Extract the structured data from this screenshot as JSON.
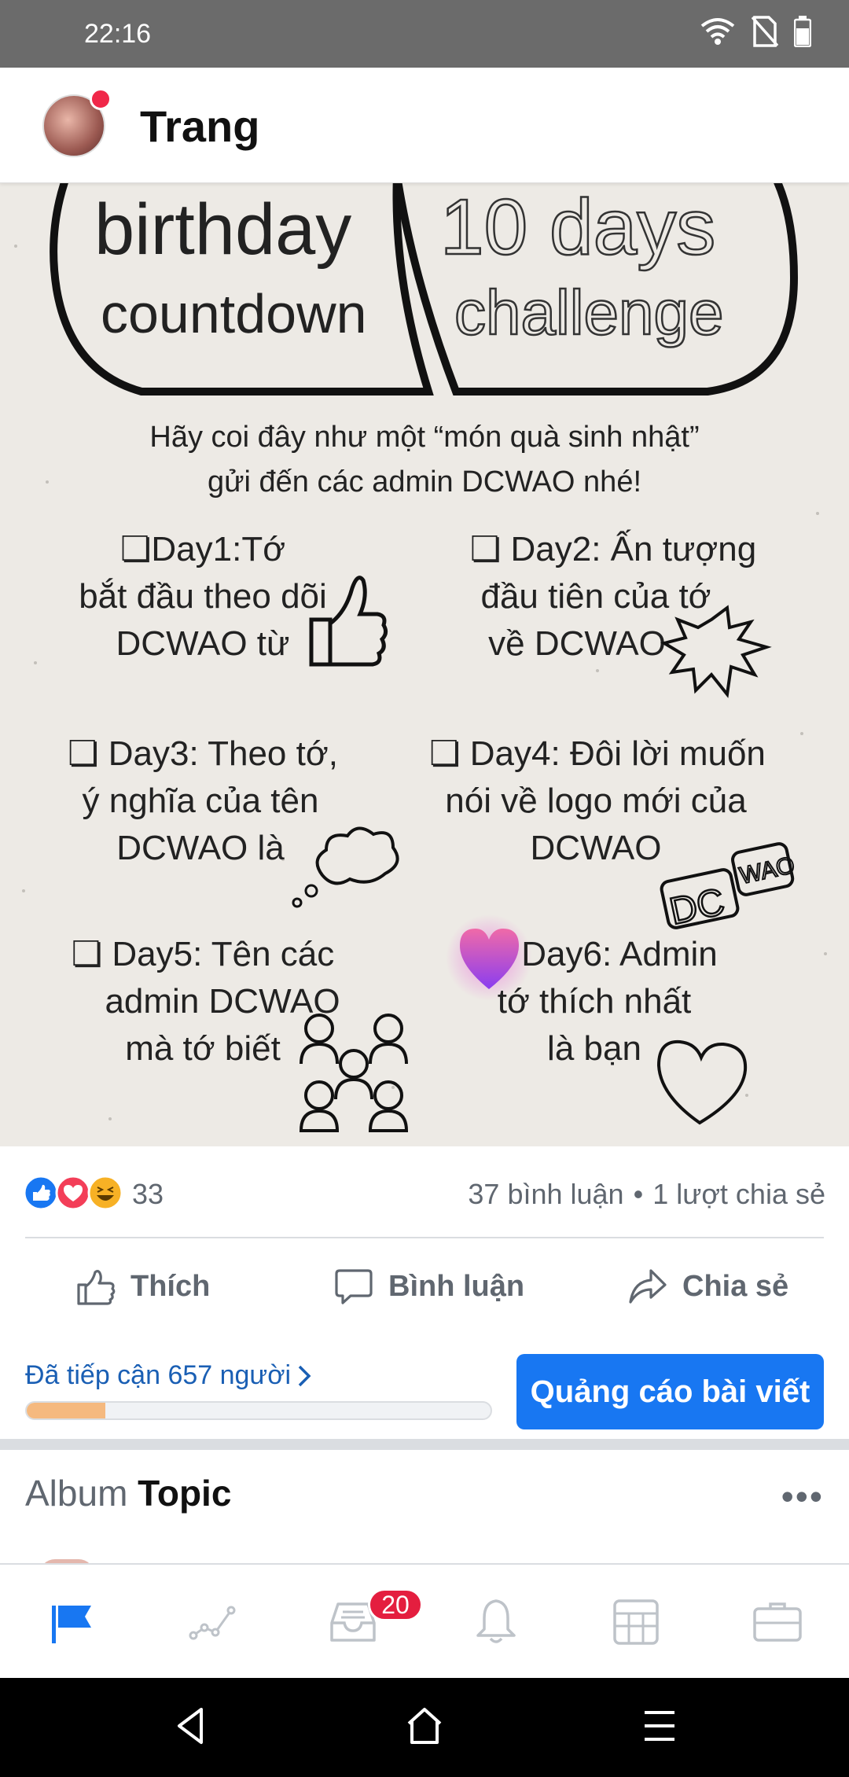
{
  "status_bar": {
    "time": "22:16"
  },
  "header": {
    "page_name": "Trang"
  },
  "post_image": {
    "title_left_1": "birthday",
    "title_left_2": "countdown",
    "title_right_1": "10 days",
    "title_right_2": "challenge",
    "intro_1": "Hãy coi đây như một  “món quà sinh nhật”",
    "intro_2": "gửi đến các admin DCWAO nhé!",
    "day1": [
      "❏Day1:Tớ",
      "bắt đầu theo dõi",
      "DCWAO từ"
    ],
    "day2": [
      "❏ Day2: Ấn tượng",
      "đầu tiên của tớ",
      "về DCWAO"
    ],
    "day3": [
      "❏ Day3: Theo tớ,",
      "ý nghĩa của tên",
      "DCWAO là"
    ],
    "day4": [
      "❏ Day4: Đôi lời muốn",
      "nói về logo mới của",
      "DCWAO"
    ],
    "day5": [
      "❏ Day5: Tên các",
      "admin DCWAO",
      "mà tớ biết"
    ],
    "day6": [
      "Day6: Admin",
      "tớ thích nhất",
      "là bạn"
    ],
    "logo_text_1": "DC",
    "logo_text_2": "WAO"
  },
  "reactions": {
    "count": "33",
    "comments": "37 bình luận",
    "separator": "•",
    "shares": "1 lượt chia sẻ"
  },
  "actions": {
    "like": "Thích",
    "comment": "Bình luận",
    "share": "Chia sẻ"
  },
  "reach": {
    "label": "Đã tiếp cận 657 người",
    "progress_fraction": 0.17,
    "promote_label": "Quảng cáo bài viết"
  },
  "album": {
    "prefix": "Album",
    "name": "Topic",
    "more": "•••"
  },
  "bottom_nav": {
    "badge_count": "20",
    "active_color": "#1877f2",
    "inactive_color": "#bec3c9",
    "items": [
      "page-flag-icon",
      "insights-icon",
      "inbox-icon",
      "notifications-icon",
      "calendar-icon",
      "tools-icon"
    ]
  },
  "colors": {
    "accent": "#1877f2",
    "reach_fill": "#f5b97f",
    "badge": "#e41e3f"
  }
}
